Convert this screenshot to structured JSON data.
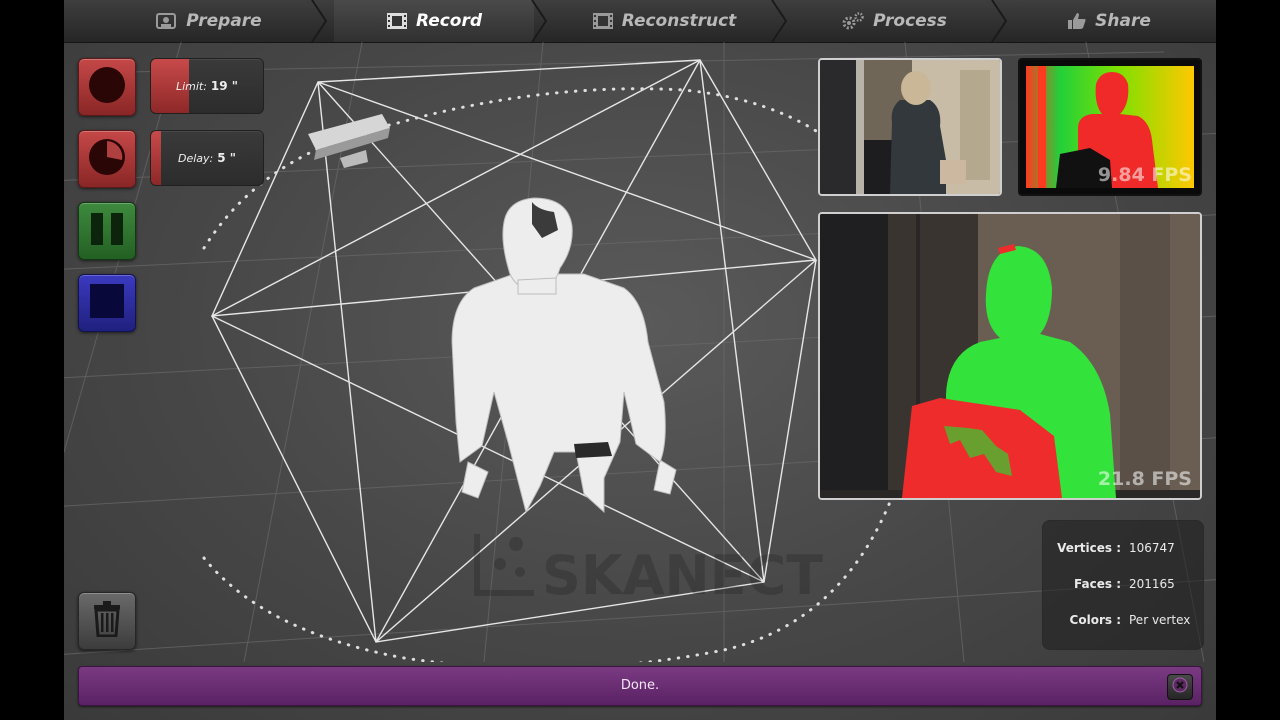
{
  "nav": {
    "tabs": [
      {
        "label": "Prepare",
        "icon": "prepare-icon"
      },
      {
        "label": "Record",
        "icon": "film-icon"
      },
      {
        "label": "Reconstruct",
        "icon": "film-icon"
      },
      {
        "label": "Process",
        "icon": "gears-icon"
      },
      {
        "label": "Share",
        "icon": "thumbs-up-icon"
      }
    ],
    "active": "Record"
  },
  "controls": {
    "limit_label": "Limit:",
    "limit_value": "19 \"",
    "delay_label": "Delay:",
    "delay_value": "5 \""
  },
  "watermark": "SKANECT",
  "previews": {
    "depth_fps": "9.84 FPS",
    "overlay_fps": "21.8 FPS"
  },
  "stats": {
    "vertices_label": "Vertices :",
    "vertices_value": "106747",
    "faces_label": "Faces :",
    "faces_value": "201165",
    "colors_label": "Colors :",
    "colors_value": "Per vertex"
  },
  "status": {
    "text": "Done."
  },
  "colors": {
    "record_red": "#a83636",
    "pause_green": "#2e7a2e",
    "stop_blue": "#2b2b9e",
    "status_purple": "#6a2c74",
    "depth_green": "#2ee82e",
    "depth_red": "#f23a2a"
  }
}
